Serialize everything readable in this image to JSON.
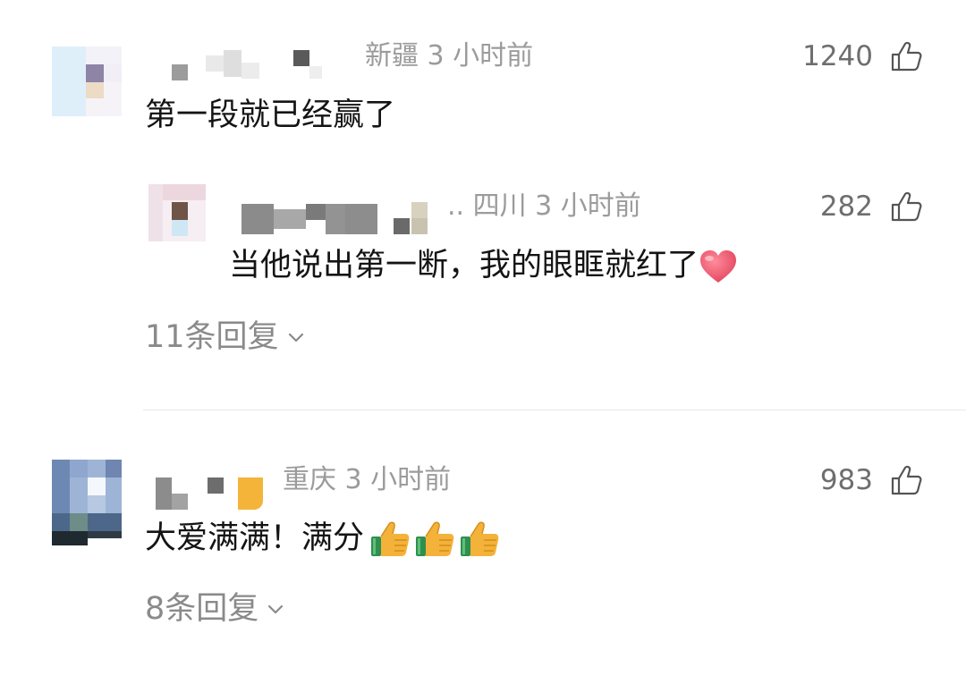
{
  "comments": [
    {
      "location": "新疆",
      "time": "3 小时前",
      "likes": "1240",
      "text": "第一段就已经赢了",
      "reply": {
        "username_tail": "..",
        "location": "四川",
        "time": "3 小时前",
        "likes": "282",
        "text": "当他说出第一断，我的眼眶就红了",
        "emoji": "heart-emoji"
      },
      "replies_label": "11条回复"
    },
    {
      "location": "重庆",
      "time": "3 小时前",
      "likes": "983",
      "text": "大爱满满！满分",
      "emoji": "thumbs-up-emoji",
      "emoji_count": 3,
      "replies_label": "8条回复"
    }
  ],
  "icons": {
    "like": "thumbs-up-outline-icon",
    "expand": "chevron-down-icon"
  },
  "colors": {
    "meta_text": "#9b9b9b",
    "like_text": "#6e6e6e",
    "body_text": "#141414",
    "reply_link": "#8a8a8a",
    "divider": "#e8e8e8",
    "heart": "#ef5a6f",
    "thumb": "#f3b23a"
  }
}
